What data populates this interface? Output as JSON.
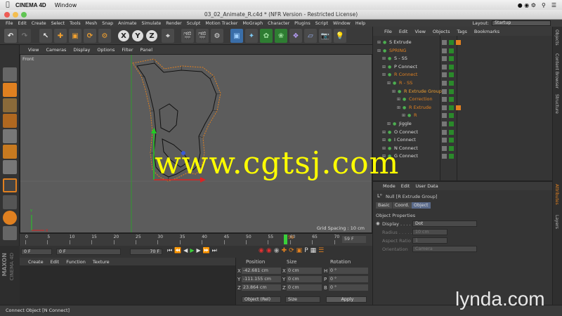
{
  "macos_menu": {
    "app_name": "CINEMA 4D",
    "window": "Window"
  },
  "window_title": "03_02_Animate_R.c4d * (NFR Version - Restricted License)",
  "main_menu": [
    "File",
    "Edit",
    "Create",
    "Select",
    "Tools",
    "Mesh",
    "Snap",
    "Animate",
    "Simulate",
    "Render",
    "Sculpt",
    "Motion Tracker",
    "MoGraph",
    "Character",
    "Plugins",
    "Script",
    "Window",
    "Help"
  ],
  "layout": {
    "label": "Layout:",
    "value": "Startup"
  },
  "toolbar_axes": {
    "x": "X",
    "y": "Y",
    "z": "Z"
  },
  "viewport": {
    "menu": [
      "View",
      "Cameras",
      "Display",
      "Options",
      "Filter",
      "Panel"
    ],
    "camera_label": "Front",
    "grid_spacing": "Grid Spacing : 10 cm"
  },
  "timeline": {
    "ticks": [
      "0",
      "5",
      "10",
      "15",
      "20",
      "25",
      "30",
      "35",
      "40",
      "45",
      "50",
      "55",
      "60",
      "65",
      "70"
    ],
    "current_frame_label": "59",
    "end_label": "59 F"
  },
  "transport": {
    "start": "0 F",
    "min": "0 F",
    "max": "70 F",
    "end": "70 F"
  },
  "material_menu": [
    "Create",
    "Edit",
    "Function",
    "Texture"
  ],
  "coordinates": {
    "headers": {
      "position": "Position",
      "size": "Size",
      "rotation": "Rotation"
    },
    "rows": [
      {
        "axis": "X",
        "pos": "-42.681 cm",
        "size_axis": "X",
        "size": "0 cm",
        "rot_axis": "H",
        "rot": "0 °"
      },
      {
        "axis": "Y",
        "pos": "-111.155 cm",
        "size_axis": "Y",
        "size": "0 cm",
        "rot_axis": "P",
        "rot": "0 °"
      },
      {
        "axis": "Z",
        "pos": "23.864 cm",
        "size_axis": "Z",
        "size": "0 cm",
        "rot_axis": "B",
        "rot": "0 °"
      }
    ],
    "mode_select": "Object (Rel)",
    "size_select": "Size",
    "apply": "Apply"
  },
  "object_manager": {
    "menu": [
      "File",
      "Edit",
      "View",
      "Objects",
      "Tags",
      "Bookmarks"
    ],
    "objects": [
      {
        "name": "S Extrude",
        "indent": 0,
        "color": "#dddddd",
        "tag_color": "#e08020"
      },
      {
        "name": "SPRING",
        "indent": 0,
        "color": "#e08020",
        "tag_color": ""
      },
      {
        "name": "S - SS",
        "indent": 1,
        "color": "#dddddd",
        "tag_color": ""
      },
      {
        "name": "P Connect",
        "indent": 1,
        "color": "#dddddd",
        "tag_color": ""
      },
      {
        "name": "R Connect",
        "indent": 1,
        "color": "#e08020",
        "tag_color": ""
      },
      {
        "name": "R - SS",
        "indent": 2,
        "color": "#e08020",
        "tag_color": ""
      },
      {
        "name": "R Extrude Group",
        "indent": 3,
        "color": "#f0a030",
        "tag_color": ""
      },
      {
        "name": "Correction",
        "indent": 4,
        "color": "#e08020",
        "tag_color": ""
      },
      {
        "name": "R Extrude",
        "indent": 4,
        "color": "#e08020",
        "tag_color": "#e08020"
      },
      {
        "name": "R",
        "indent": 5,
        "color": "#e08020",
        "tag_color": ""
      },
      {
        "name": "Jiggle",
        "indent": 2,
        "color": "#dddddd",
        "tag_color": ""
      },
      {
        "name": "O Connect",
        "indent": 1,
        "color": "#dddddd",
        "tag_color": ""
      },
      {
        "name": "I Connect",
        "indent": 1,
        "color": "#dddddd",
        "tag_color": ""
      },
      {
        "name": "N Connect",
        "indent": 1,
        "color": "#dddddd",
        "tag_color": ""
      },
      {
        "name": "G Connect",
        "indent": 1,
        "color": "#dddddd",
        "tag_color": ""
      }
    ]
  },
  "attributes": {
    "menu": [
      "Mode",
      "Edit",
      "User Data"
    ],
    "object_title": "Null [R Extrude Group]",
    "tabs": [
      "Basic",
      "Coord.",
      "Object"
    ],
    "section": "Object Properties",
    "display_label": "Display . . . .",
    "display_value": "Dot",
    "radius_label": "Radius . . . . .",
    "radius_value": "10 cm",
    "aspect_label": "Aspect Ratio",
    "aspect_value": "1",
    "orientation_label": "Orientation",
    "orientation_value": "Camera"
  },
  "side_tabs": [
    "Objects",
    "Content Browser",
    "Structure",
    "Attributes",
    "Layers"
  ],
  "branding": {
    "maxon": "MAXON",
    "cinema": "CINEMA 4D"
  },
  "status": "Connect Object [N Connect]",
  "watermark": "www.cgtsj.com",
  "lynda": "lynda.com"
}
